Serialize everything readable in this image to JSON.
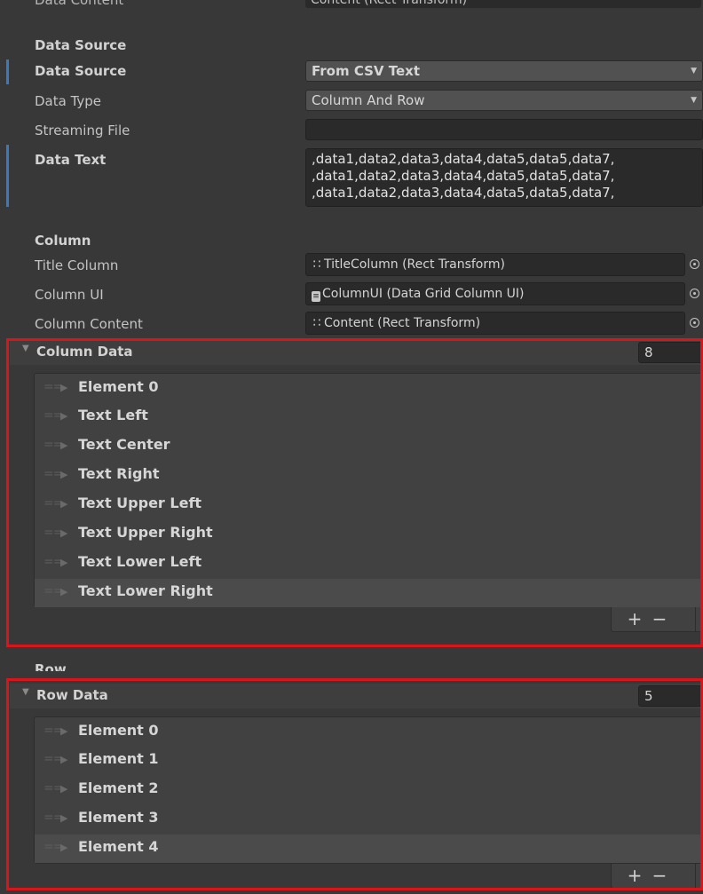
{
  "cutoff": {
    "label": "Data Content",
    "field": "Content (Rect Transform)"
  },
  "data_source_section": {
    "header": "Data Source",
    "data_source": {
      "label": "Data Source",
      "value": "From CSV Text"
    },
    "data_type": {
      "label": "Data Type",
      "value": "Column And Row"
    },
    "streaming_file": {
      "label": "Streaming File",
      "value": ""
    },
    "data_text": {
      "label": "Data Text",
      "lines": [
        ",data1,data2,data3,data4,data5,data5,data7,",
        ",data1,data2,data3,data4,data5,data5,data7,",
        ",data1,data2,data3,data4,data5,data5,data7,"
      ]
    }
  },
  "column_section": {
    "header": "Column",
    "title_column": {
      "label": "Title Column",
      "value": "TitleColumn (Rect Transform)",
      "icon": "rect-transform-icon"
    },
    "column_ui": {
      "label": "Column UI",
      "value": "ColumnUI (Data Grid Column UI)",
      "icon": "script-icon"
    },
    "column_content": {
      "label": "Column Content",
      "value": "Content (Rect Transform)",
      "icon": "rect-transform-icon"
    }
  },
  "column_data": {
    "header": "Column Data",
    "count": "8",
    "items": [
      "Element 0",
      "Text Left",
      "Text Center",
      "Text Right",
      "Text Upper Left",
      "Text Upper Right",
      "Text Lower Left",
      "Text Lower Right"
    ],
    "add_label": "+",
    "remove_label": "−"
  },
  "row_section": {
    "header": "Row"
  },
  "row_data": {
    "header": "Row Data",
    "count": "5",
    "items": [
      "Element 0",
      "Element 1",
      "Element 2",
      "Element 3",
      "Element 4"
    ],
    "add_label": "+",
    "remove_label": "−"
  },
  "colors": {
    "background": "#383838",
    "highlight_border": "#d9141b",
    "accent_bar": "#3a79bb"
  }
}
